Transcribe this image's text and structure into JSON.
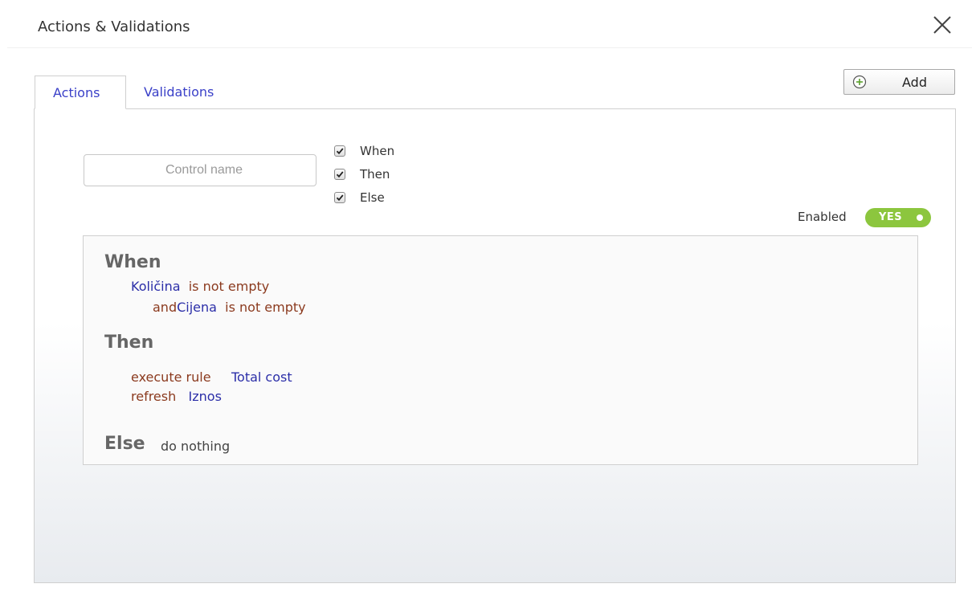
{
  "dialog": {
    "title": "Actions & Validations",
    "close_glyph": "×"
  },
  "tabs": [
    {
      "label": "Actions",
      "active": true
    },
    {
      "label": "Validations",
      "active": false
    }
  ],
  "add_button": {
    "label": "Add",
    "icon": "plus-circle-icon"
  },
  "control_name": {
    "placeholder": "Control name",
    "value": ""
  },
  "filters": [
    {
      "label": "When",
      "checked": true
    },
    {
      "label": "Then",
      "checked": true
    },
    {
      "label": "Else",
      "checked": true
    }
  ],
  "enabled": {
    "label": "Enabled",
    "value": "YES",
    "on": true
  },
  "rule": {
    "when": {
      "heading": "When",
      "conditions": [
        {
          "prefix": "",
          "field": "Količina",
          "operator": "is not empty"
        },
        {
          "prefix": "and",
          "field": "Cijena",
          "operator": "is not empty"
        }
      ]
    },
    "then": {
      "heading": "Then",
      "actions": [
        {
          "verb": "execute rule",
          "target": "Total cost"
        },
        {
          "verb": "refresh",
          "target": "Iznos"
        }
      ]
    },
    "else": {
      "heading": "Else",
      "text": "do nothing"
    }
  },
  "colors": {
    "link_blue": "#3a40c8",
    "field_blue": "#2b2ea8",
    "operator_brown": "#8b3a1e",
    "toggle_green": "#8cc63e"
  }
}
